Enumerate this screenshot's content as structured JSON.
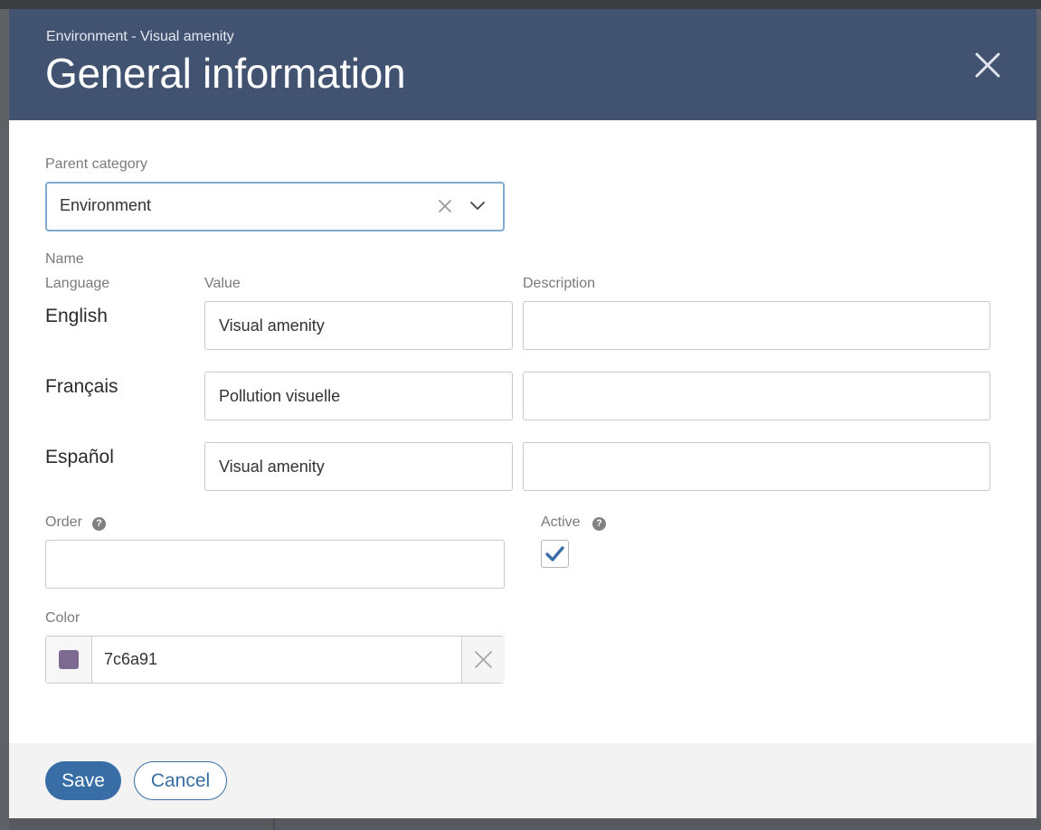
{
  "modal": {
    "breadcrumb": "Environment - Visual amenity",
    "title": "General information"
  },
  "parent_category": {
    "label": "Parent category",
    "value": "Environment"
  },
  "name_section": {
    "label": "Name",
    "col_language": "Language",
    "col_value": "Value",
    "col_description": "Description",
    "rows": [
      {
        "language": "English",
        "value": "Visual amenity",
        "description": ""
      },
      {
        "language": "Français",
        "value": "Pollution visuelle",
        "description": ""
      },
      {
        "language": "Español",
        "value": "Visual amenity",
        "description": ""
      }
    ]
  },
  "order": {
    "label": "Order",
    "value": ""
  },
  "active": {
    "label": "Active",
    "checked": true
  },
  "color": {
    "label": "Color",
    "value": "7c6a91",
    "swatch": "#7c6a91"
  },
  "footer": {
    "save_label": "Save",
    "cancel_label": "Cancel"
  },
  "colors": {
    "header_bg": "#415370",
    "primary": "#386ea5",
    "focus_border": "#7fa9cf"
  },
  "icons": {
    "close": "close-icon",
    "clear": "clear-icon",
    "chevron": "chevron-down-icon",
    "help": "help-icon",
    "check": "check-icon"
  }
}
